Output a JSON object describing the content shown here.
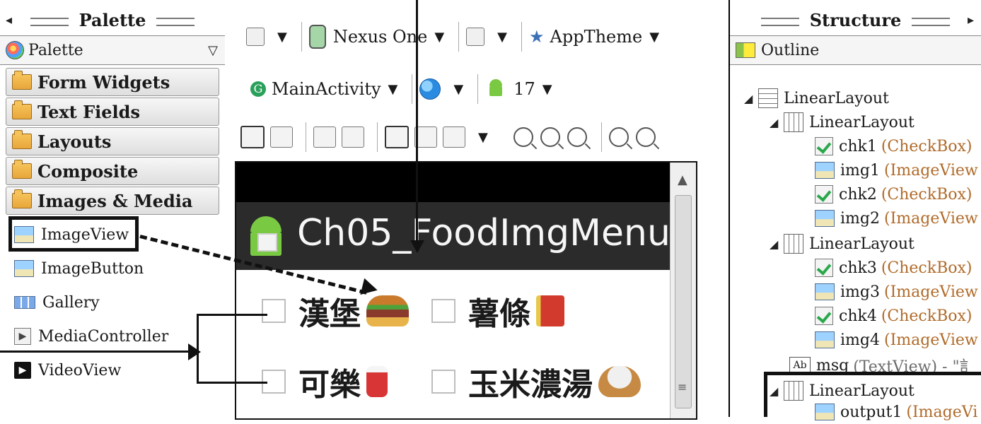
{
  "palette": {
    "title": "Palette",
    "dropdown_label": "Palette",
    "categories": [
      "Form Widgets",
      "Text Fields",
      "Layouts",
      "Composite",
      "Images & Media"
    ],
    "items": [
      "ImageView",
      "ImageButton",
      "Gallery",
      "MediaController",
      "VideoView"
    ]
  },
  "toolbar": {
    "device": "Nexus One",
    "theme": "AppTheme",
    "activity": "MainActivity",
    "api": "17"
  },
  "preview": {
    "app_title": "Ch05_FoodImgMenu",
    "options": [
      "漢堡",
      "薯條",
      "可樂",
      "玉米濃湯"
    ]
  },
  "structure": {
    "title": "Structure",
    "outline_label": "Outline",
    "tree": [
      {
        "label": "LinearLayout"
      },
      {
        "label": "LinearLayout"
      },
      {
        "id": "chk1",
        "type": "(CheckBox)"
      },
      {
        "id": "img1",
        "type": "(ImageView"
      },
      {
        "id": "chk2",
        "type": "(CheckBox)"
      },
      {
        "id": "img2",
        "type": "(ImageView"
      },
      {
        "label": "LinearLayout"
      },
      {
        "id": "chk3",
        "type": "(CheckBox)"
      },
      {
        "id": "img3",
        "type": "(ImageView"
      },
      {
        "id": "chk4",
        "type": "(CheckBox)"
      },
      {
        "id": "img4",
        "type": "(ImageView"
      },
      {
        "id": "msg",
        "type": "(TextView) - \"訁"
      },
      {
        "label": "LinearLayout"
      },
      {
        "id": "output1",
        "type": "(ImageVi"
      }
    ]
  }
}
